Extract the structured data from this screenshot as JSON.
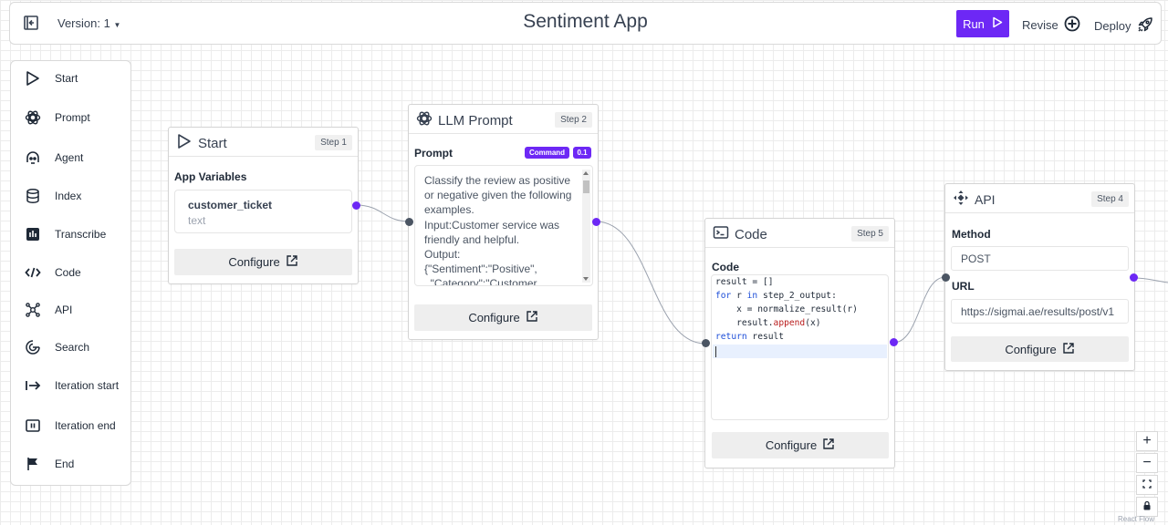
{
  "header": {
    "version_label": "Version: 1",
    "title": "Sentiment App",
    "run_label": "Run",
    "revise_label": "Revise",
    "deploy_label": "Deploy"
  },
  "sidebar": {
    "items": [
      {
        "label": "Start",
        "icon": "play-outline-icon"
      },
      {
        "label": "Prompt",
        "icon": "openai-icon"
      },
      {
        "label": "Agent",
        "icon": "agent-icon"
      },
      {
        "label": "Index",
        "icon": "database-icon"
      },
      {
        "label": "Transcribe",
        "icon": "transcribe-icon"
      },
      {
        "label": "Code",
        "icon": "code-icon"
      },
      {
        "label": "API",
        "icon": "api-icon"
      },
      {
        "label": "Search",
        "icon": "search-icon"
      },
      {
        "label": "Iteration start",
        "icon": "arrow-right-bar-icon"
      },
      {
        "label": "Iteration end",
        "icon": "pause-box-icon"
      },
      {
        "label": "End",
        "icon": "flag-icon"
      }
    ]
  },
  "nodes": {
    "start": {
      "title": "Start",
      "step": "Step 1",
      "section_label": "App Variables",
      "variable_name": "customer_ticket",
      "variable_type": "text",
      "configure_label": "Configure"
    },
    "prompt": {
      "title": "LLM Prompt",
      "step": "Step 2",
      "section_label": "Prompt",
      "tag_command": "Command",
      "tag_version": "0.1",
      "text": "Classify the review as positive\nor negative given the following\nexamples.\nInput:Customer service was\nfriendly and helpful.\nOutput:\n{\"Sentiment\":\"Positive\",\n  \"Category\":\"Customer",
      "configure_label": "Configure"
    },
    "code": {
      "title": "Code",
      "step": "Step 5",
      "section_label": "Code",
      "lines": [
        "result = []",
        "for r in step_2_output:",
        "    x = normalize_result(r)",
        "    result.append(x)",
        "return result"
      ],
      "configure_label": "Configure"
    },
    "api": {
      "title": "API",
      "step": "Step 4",
      "method_label": "Method",
      "method_value": "POST",
      "url_label": "URL",
      "url_value": "https://sigmai.ae/results/post/v1",
      "configure_label": "Configure"
    }
  },
  "canvas_controls": {
    "zoom_in": "+",
    "zoom_out": "−",
    "attribution": "React Flow"
  },
  "colors": {
    "accent": "#6d28f5",
    "edge": "#9ca3af",
    "input_handle": "#4b5563"
  }
}
